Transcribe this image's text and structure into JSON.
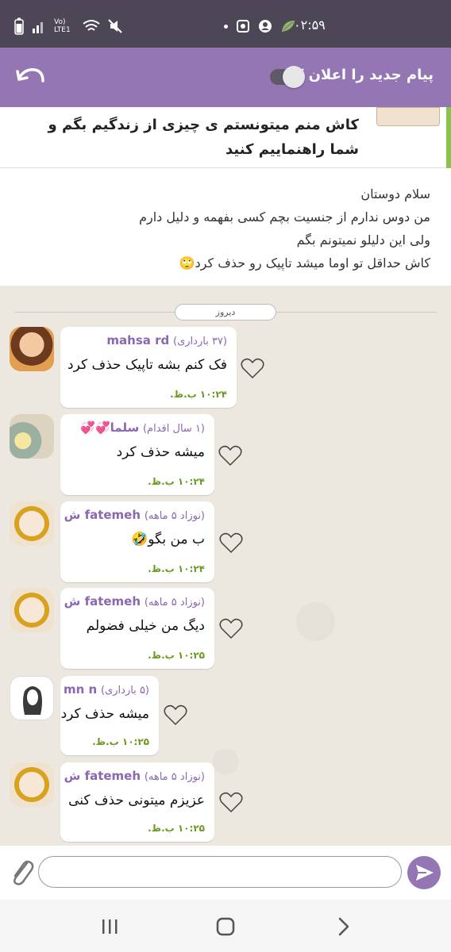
{
  "status": {
    "time": "۰۲:۵۹",
    "carrier": "Vo) LTE1"
  },
  "appbar": {
    "title": "پیام جدید را اعلان کن",
    "notify_toggle": false
  },
  "topic": {
    "title": "کاش منم میتونستم ی چیزی از زندگیم بگم و شما راهنماییم کنید"
  },
  "post": {
    "lines": [
      "سلام دوستان",
      "من دوس ندارم از جنسیت بچم کسی بفهمه و دلیل دارم",
      "ولی این دلیلو نمیتونم بگم",
      "کاش حداقل تو اوما میشد تاپیک رو حذف کرد🙄"
    ]
  },
  "chat": {
    "day_label": "دیروز",
    "messages": [
      {
        "name": "mahsa rd",
        "sub": "(۳۷ بارداری)",
        "text": "فک کنم بشه تاپیک حذف کرد",
        "time": "۱۰:۲۴ ب.ظ."
      },
      {
        "name": "سلما💞💞",
        "sub": "(۱ سال اقدام)",
        "text": "میشه حذف کرد",
        "time": "۱۰:۲۴ ب.ظ."
      },
      {
        "name": "fatemeh ش",
        "sub": "(نوزاد ۵ ماهه)",
        "text": "ب من بگو🤣",
        "time": "۱۰:۲۴ ب.ظ."
      },
      {
        "name": "fatemeh ش",
        "sub": "(نوزاد ۵ ماهه)",
        "text": "دیگ من خیلی فضولم",
        "time": "۱۰:۲۵ ب.ظ."
      },
      {
        "name": "mn n",
        "sub": "(۵ بارداری)",
        "text": "میشه حذف کرد",
        "time": "۱۰:۲۵ ب.ظ."
      },
      {
        "name": "fatemeh ش",
        "sub": "(نوزاد ۵ ماهه)",
        "text": "عزیزم میتونی حذف کنی",
        "time": "۱۰:۲۵ ب.ظ."
      }
    ]
  },
  "input": {
    "placeholder": ""
  },
  "colors": {
    "accent": "#9476b5",
    "name": "#8a67b0",
    "time": "#6a9a1f",
    "statusbar": "#4c4657",
    "topic_accent": "#8bc34a"
  },
  "icons": [
    "back-arrow-icon",
    "attach-icon",
    "send-icon",
    "heart-icon",
    "nav-recents-icon",
    "nav-home-icon",
    "nav-back-icon"
  ]
}
